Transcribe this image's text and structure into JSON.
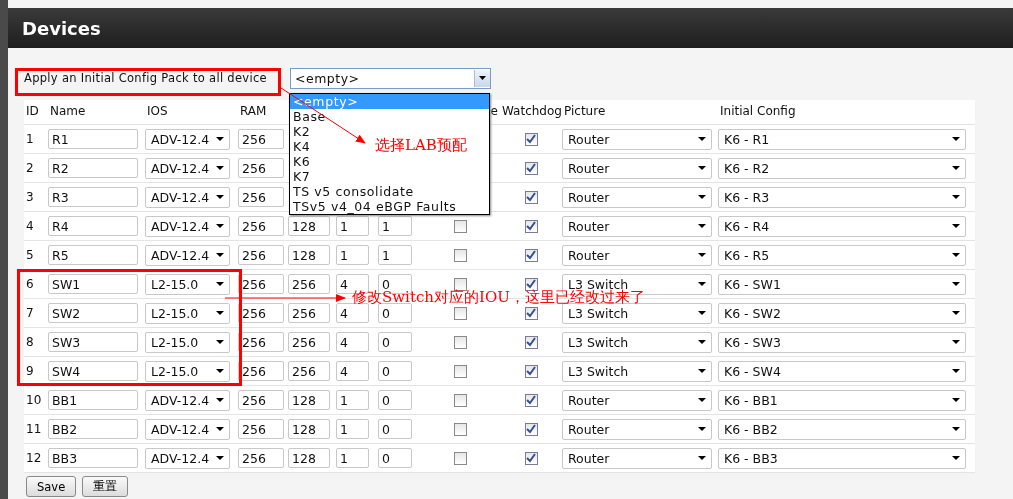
{
  "page": {
    "title": "Devices"
  },
  "config_pack": {
    "label": "Apply an Initial Config Pack to all device",
    "value": "<empty>",
    "options": [
      {
        "label": "<empty>",
        "selected": true
      },
      {
        "label": "Base",
        "selected": false
      },
      {
        "label": "K2",
        "selected": false
      },
      {
        "label": "K4",
        "selected": false
      },
      {
        "label": "K6",
        "selected": false
      },
      {
        "label": "K7",
        "selected": false
      },
      {
        "label": "TS v5 consolidate",
        "selected": false
      },
      {
        "label": "TSv5 v4_04 eBGP Faults",
        "selected": false
      }
    ]
  },
  "columns": {
    "id": "ID",
    "name": "Name",
    "ios": "IOS",
    "ram": "RAM",
    "column_8": "e",
    "watchdog": "Watchdog",
    "picture": "Picture",
    "initial_config": "Initial Config"
  },
  "rows": [
    {
      "id": "1",
      "name": "R1",
      "ios": "ADV-12.4",
      "ram": "256",
      "watchdog": true,
      "picture": "Router",
      "initial_config": "K6 - R1"
    },
    {
      "id": "2",
      "name": "R2",
      "ios": "ADV-12.4",
      "ram": "256",
      "watchdog": true,
      "picture": "Router",
      "initial_config": "K6 - R2"
    },
    {
      "id": "3",
      "name": "R3",
      "ios": "ADV-12.4",
      "ram": "256",
      "watchdog": true,
      "picture": "Router",
      "initial_config": "K6 - R3"
    },
    {
      "id": "4",
      "name": "R4",
      "ios": "ADV-12.4",
      "ram": "256",
      "column_5": "128",
      "column_6": "1",
      "column_7": "1",
      "column_8": false,
      "watchdog": true,
      "picture": "Router",
      "initial_config": "K6 - R4"
    },
    {
      "id": "5",
      "name": "R5",
      "ios": "ADV-12.4",
      "ram": "256",
      "column_5": "128",
      "column_6": "1",
      "column_7": "1",
      "column_8": false,
      "watchdog": true,
      "picture": "Router",
      "initial_config": "K6 - R5"
    },
    {
      "id": "6",
      "name": "SW1",
      "ios": "L2-15.0",
      "ram": "256",
      "column_5": "256",
      "column_6": "4",
      "column_7": "0",
      "column_8": false,
      "watchdog": true,
      "picture": "L3 Switch",
      "initial_config": "K6 - SW1"
    },
    {
      "id": "7",
      "name": "SW2",
      "ios": "L2-15.0",
      "ram": "256",
      "column_5": "256",
      "column_6": "4",
      "column_7": "0",
      "column_8": false,
      "watchdog": true,
      "picture": "L3 Switch",
      "initial_config": "K6 - SW2"
    },
    {
      "id": "8",
      "name": "SW3",
      "ios": "L2-15.0",
      "ram": "256",
      "column_5": "256",
      "column_6": "4",
      "column_7": "0",
      "column_8": false,
      "watchdog": true,
      "picture": "L3 Switch",
      "initial_config": "K6 - SW3"
    },
    {
      "id": "9",
      "name": "SW4",
      "ios": "L2-15.0",
      "ram": "256",
      "column_5": "256",
      "column_6": "4",
      "column_7": "0",
      "column_8": false,
      "watchdog": true,
      "picture": "L3 Switch",
      "initial_config": "K6 - SW4"
    },
    {
      "id": "10",
      "name": "BB1",
      "ios": "ADV-12.4",
      "ram": "256",
      "column_5": "128",
      "column_6": "1",
      "column_7": "0",
      "column_8": false,
      "watchdog": true,
      "picture": "Router",
      "initial_config": "K6 - BB1"
    },
    {
      "id": "11",
      "name": "BB2",
      "ios": "ADV-12.4",
      "ram": "256",
      "column_5": "128",
      "column_6": "1",
      "column_7": "0",
      "column_8": false,
      "watchdog": true,
      "picture": "Router",
      "initial_config": "K6 - BB2"
    },
    {
      "id": "12",
      "name": "BB3",
      "ios": "ADV-12.4",
      "ram": "256",
      "column_5": "128",
      "column_6": "1",
      "column_7": "0",
      "column_8": false,
      "watchdog": true,
      "picture": "Router",
      "initial_config": "K6 - BB3"
    }
  ],
  "buttons": [
    "Save",
    "重置"
  ],
  "annotations": [
    {
      "kind": "callout",
      "text": "选择LAB预配"
    },
    {
      "kind": "callout",
      "text": "修改Switch对应的IOU，这里已经改过来了"
    }
  ]
}
